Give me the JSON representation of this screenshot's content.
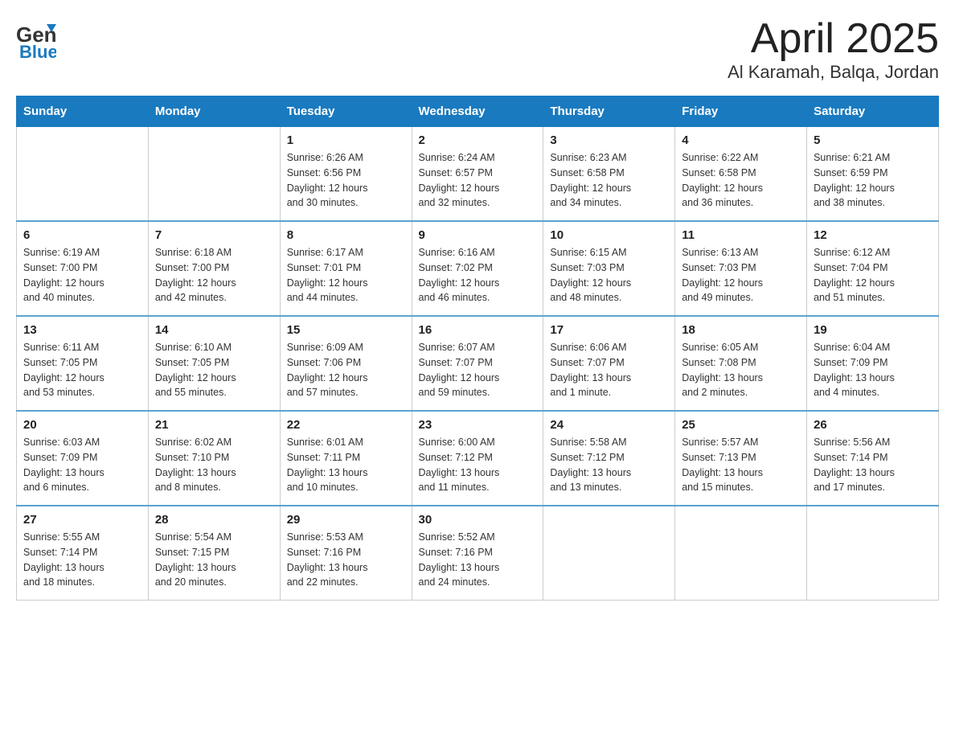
{
  "header": {
    "title": "April 2025",
    "subtitle": "Al Karamah, Balqa, Jordan",
    "logo_general": "General",
    "logo_blue": "Blue"
  },
  "weekdays": [
    "Sunday",
    "Monday",
    "Tuesday",
    "Wednesday",
    "Thursday",
    "Friday",
    "Saturday"
  ],
  "weeks": [
    [
      {
        "day": "",
        "info": ""
      },
      {
        "day": "",
        "info": ""
      },
      {
        "day": "1",
        "info": "Sunrise: 6:26 AM\nSunset: 6:56 PM\nDaylight: 12 hours\nand 30 minutes."
      },
      {
        "day": "2",
        "info": "Sunrise: 6:24 AM\nSunset: 6:57 PM\nDaylight: 12 hours\nand 32 minutes."
      },
      {
        "day": "3",
        "info": "Sunrise: 6:23 AM\nSunset: 6:58 PM\nDaylight: 12 hours\nand 34 minutes."
      },
      {
        "day": "4",
        "info": "Sunrise: 6:22 AM\nSunset: 6:58 PM\nDaylight: 12 hours\nand 36 minutes."
      },
      {
        "day": "5",
        "info": "Sunrise: 6:21 AM\nSunset: 6:59 PM\nDaylight: 12 hours\nand 38 minutes."
      }
    ],
    [
      {
        "day": "6",
        "info": "Sunrise: 6:19 AM\nSunset: 7:00 PM\nDaylight: 12 hours\nand 40 minutes."
      },
      {
        "day": "7",
        "info": "Sunrise: 6:18 AM\nSunset: 7:00 PM\nDaylight: 12 hours\nand 42 minutes."
      },
      {
        "day": "8",
        "info": "Sunrise: 6:17 AM\nSunset: 7:01 PM\nDaylight: 12 hours\nand 44 minutes."
      },
      {
        "day": "9",
        "info": "Sunrise: 6:16 AM\nSunset: 7:02 PM\nDaylight: 12 hours\nand 46 minutes."
      },
      {
        "day": "10",
        "info": "Sunrise: 6:15 AM\nSunset: 7:03 PM\nDaylight: 12 hours\nand 48 minutes."
      },
      {
        "day": "11",
        "info": "Sunrise: 6:13 AM\nSunset: 7:03 PM\nDaylight: 12 hours\nand 49 minutes."
      },
      {
        "day": "12",
        "info": "Sunrise: 6:12 AM\nSunset: 7:04 PM\nDaylight: 12 hours\nand 51 minutes."
      }
    ],
    [
      {
        "day": "13",
        "info": "Sunrise: 6:11 AM\nSunset: 7:05 PM\nDaylight: 12 hours\nand 53 minutes."
      },
      {
        "day": "14",
        "info": "Sunrise: 6:10 AM\nSunset: 7:05 PM\nDaylight: 12 hours\nand 55 minutes."
      },
      {
        "day": "15",
        "info": "Sunrise: 6:09 AM\nSunset: 7:06 PM\nDaylight: 12 hours\nand 57 minutes."
      },
      {
        "day": "16",
        "info": "Sunrise: 6:07 AM\nSunset: 7:07 PM\nDaylight: 12 hours\nand 59 minutes."
      },
      {
        "day": "17",
        "info": "Sunrise: 6:06 AM\nSunset: 7:07 PM\nDaylight: 13 hours\nand 1 minute."
      },
      {
        "day": "18",
        "info": "Sunrise: 6:05 AM\nSunset: 7:08 PM\nDaylight: 13 hours\nand 2 minutes."
      },
      {
        "day": "19",
        "info": "Sunrise: 6:04 AM\nSunset: 7:09 PM\nDaylight: 13 hours\nand 4 minutes."
      }
    ],
    [
      {
        "day": "20",
        "info": "Sunrise: 6:03 AM\nSunset: 7:09 PM\nDaylight: 13 hours\nand 6 minutes."
      },
      {
        "day": "21",
        "info": "Sunrise: 6:02 AM\nSunset: 7:10 PM\nDaylight: 13 hours\nand 8 minutes."
      },
      {
        "day": "22",
        "info": "Sunrise: 6:01 AM\nSunset: 7:11 PM\nDaylight: 13 hours\nand 10 minutes."
      },
      {
        "day": "23",
        "info": "Sunrise: 6:00 AM\nSunset: 7:12 PM\nDaylight: 13 hours\nand 11 minutes."
      },
      {
        "day": "24",
        "info": "Sunrise: 5:58 AM\nSunset: 7:12 PM\nDaylight: 13 hours\nand 13 minutes."
      },
      {
        "day": "25",
        "info": "Sunrise: 5:57 AM\nSunset: 7:13 PM\nDaylight: 13 hours\nand 15 minutes."
      },
      {
        "day": "26",
        "info": "Sunrise: 5:56 AM\nSunset: 7:14 PM\nDaylight: 13 hours\nand 17 minutes."
      }
    ],
    [
      {
        "day": "27",
        "info": "Sunrise: 5:55 AM\nSunset: 7:14 PM\nDaylight: 13 hours\nand 18 minutes."
      },
      {
        "day": "28",
        "info": "Sunrise: 5:54 AM\nSunset: 7:15 PM\nDaylight: 13 hours\nand 20 minutes."
      },
      {
        "day": "29",
        "info": "Sunrise: 5:53 AM\nSunset: 7:16 PM\nDaylight: 13 hours\nand 22 minutes."
      },
      {
        "day": "30",
        "info": "Sunrise: 5:52 AM\nSunset: 7:16 PM\nDaylight: 13 hours\nand 24 minutes."
      },
      {
        "day": "",
        "info": ""
      },
      {
        "day": "",
        "info": ""
      },
      {
        "day": "",
        "info": ""
      }
    ]
  ]
}
